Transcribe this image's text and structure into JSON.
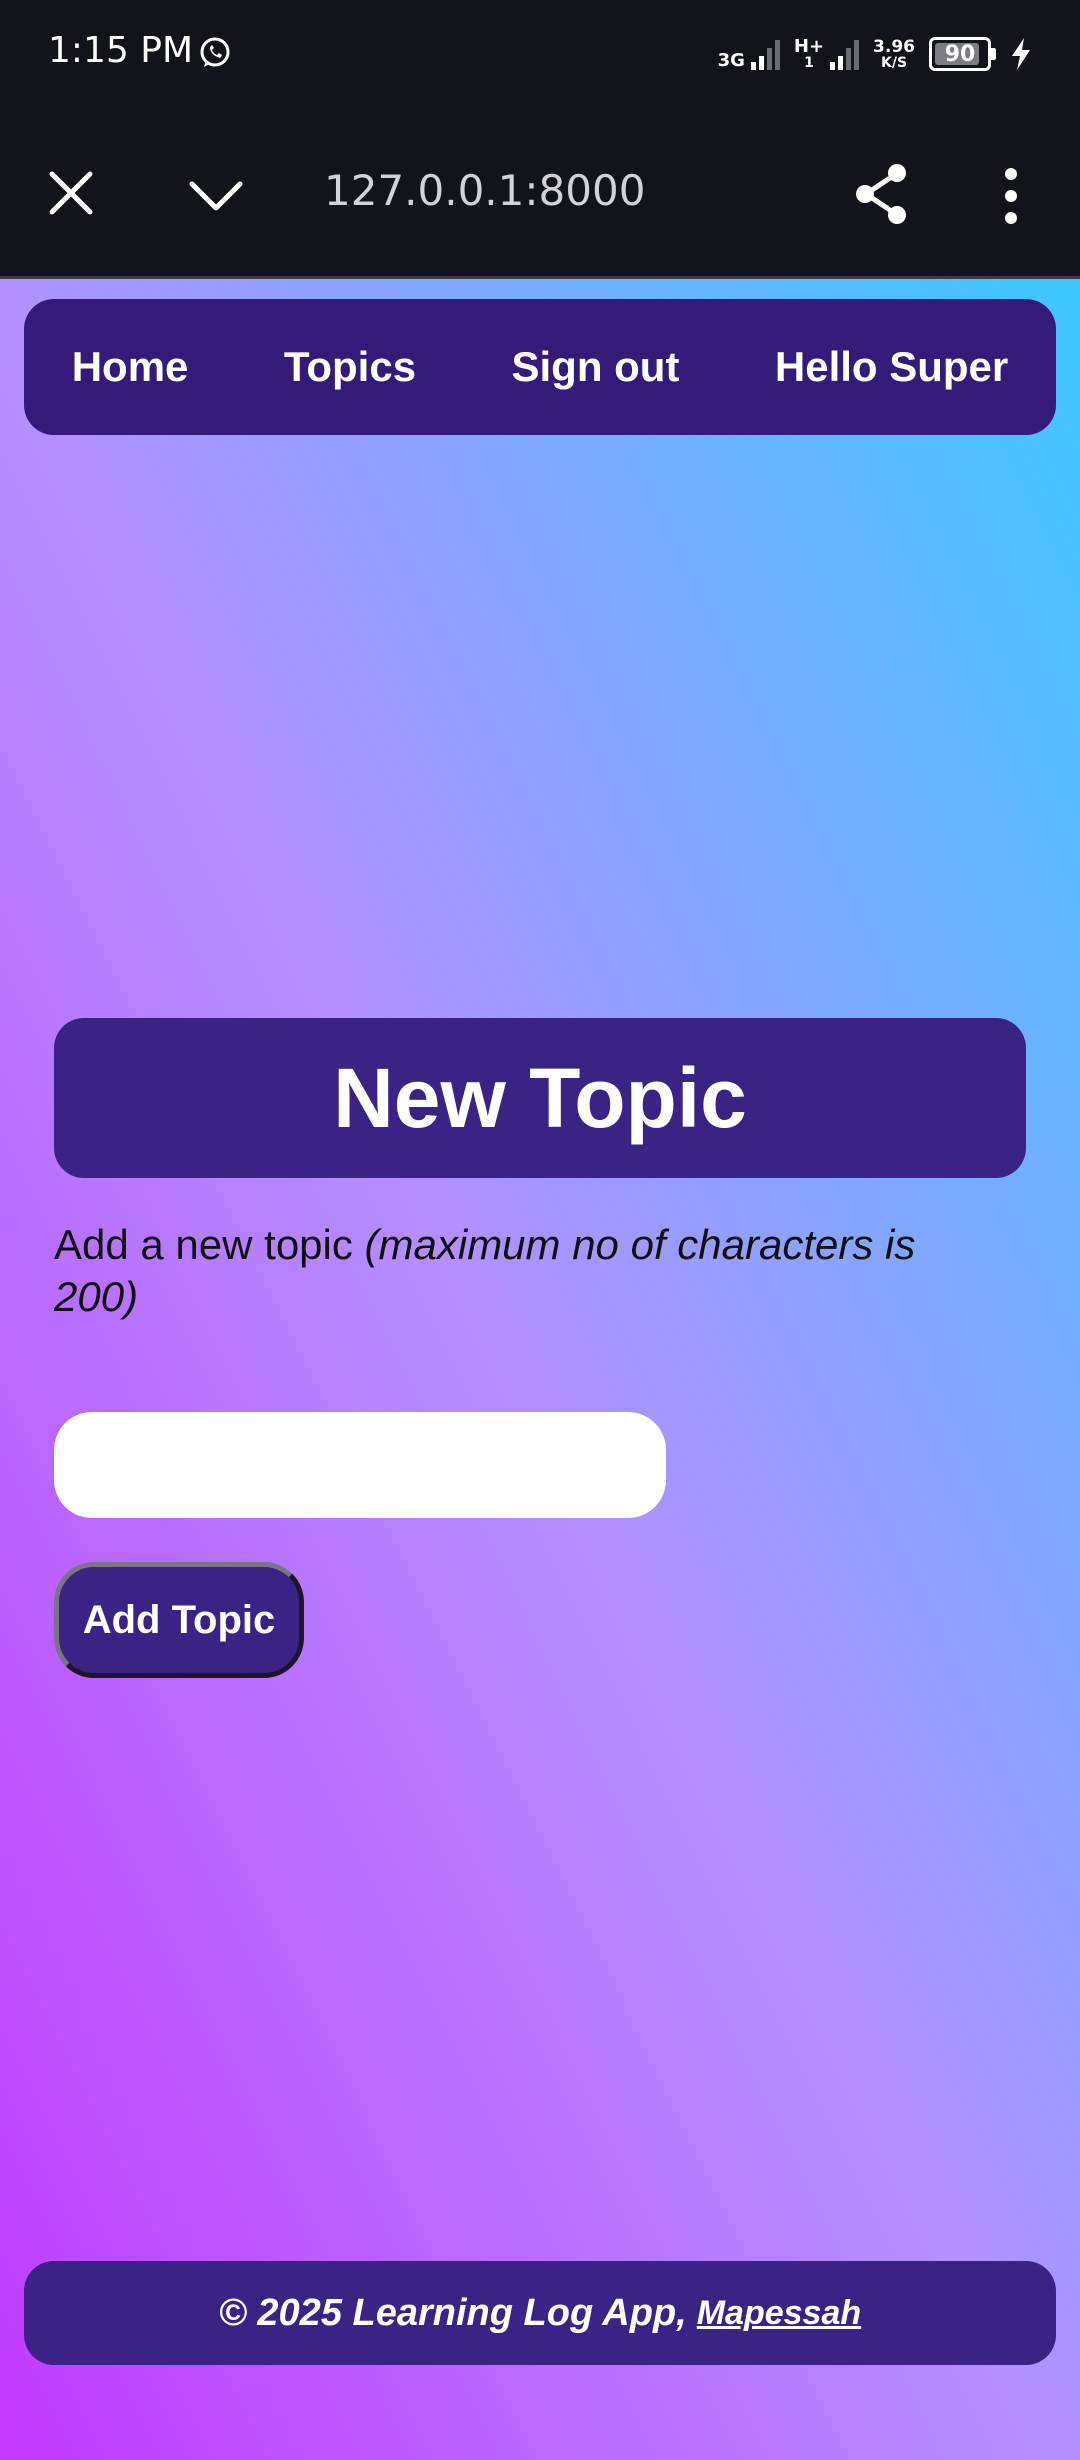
{
  "status_bar": {
    "time": "1:15 PM",
    "network1": "3G",
    "network2": "H+",
    "network2_sub": "1",
    "speed_value": "3.96",
    "speed_unit": "K/S",
    "battery": "90",
    "battery_level": 0.9,
    "icons": [
      "whatsapp-icon",
      "signal-icon",
      "battery-icon",
      "charging-icon"
    ]
  },
  "browser": {
    "url": "127.0.0.1:8000",
    "icons": [
      "close-icon",
      "chevron-down-icon",
      "share-icon",
      "more-vertical-icon"
    ]
  },
  "nav": {
    "items": [
      {
        "label": "Home"
      },
      {
        "label": "Topics"
      },
      {
        "label": "Sign out"
      },
      {
        "label": "Hello Super"
      }
    ]
  },
  "main": {
    "title": "New Topic",
    "description_plain": "Add a new topic ",
    "description_italic": "(maximum no of characters is 200)",
    "input_value": "",
    "submit_label": "Add Topic"
  },
  "footer": {
    "text": "© 2025 Learning Log App,",
    "link": "Mapessah"
  },
  "colors": {
    "chrome_bg": "#12131b",
    "nav_bg": "#351b79",
    "panel_bg": "#3b2385",
    "gradient_bottom_left": "#c039ff",
    "gradient_middle": "#b48fff",
    "gradient_top_right": "#3cc8ff"
  }
}
